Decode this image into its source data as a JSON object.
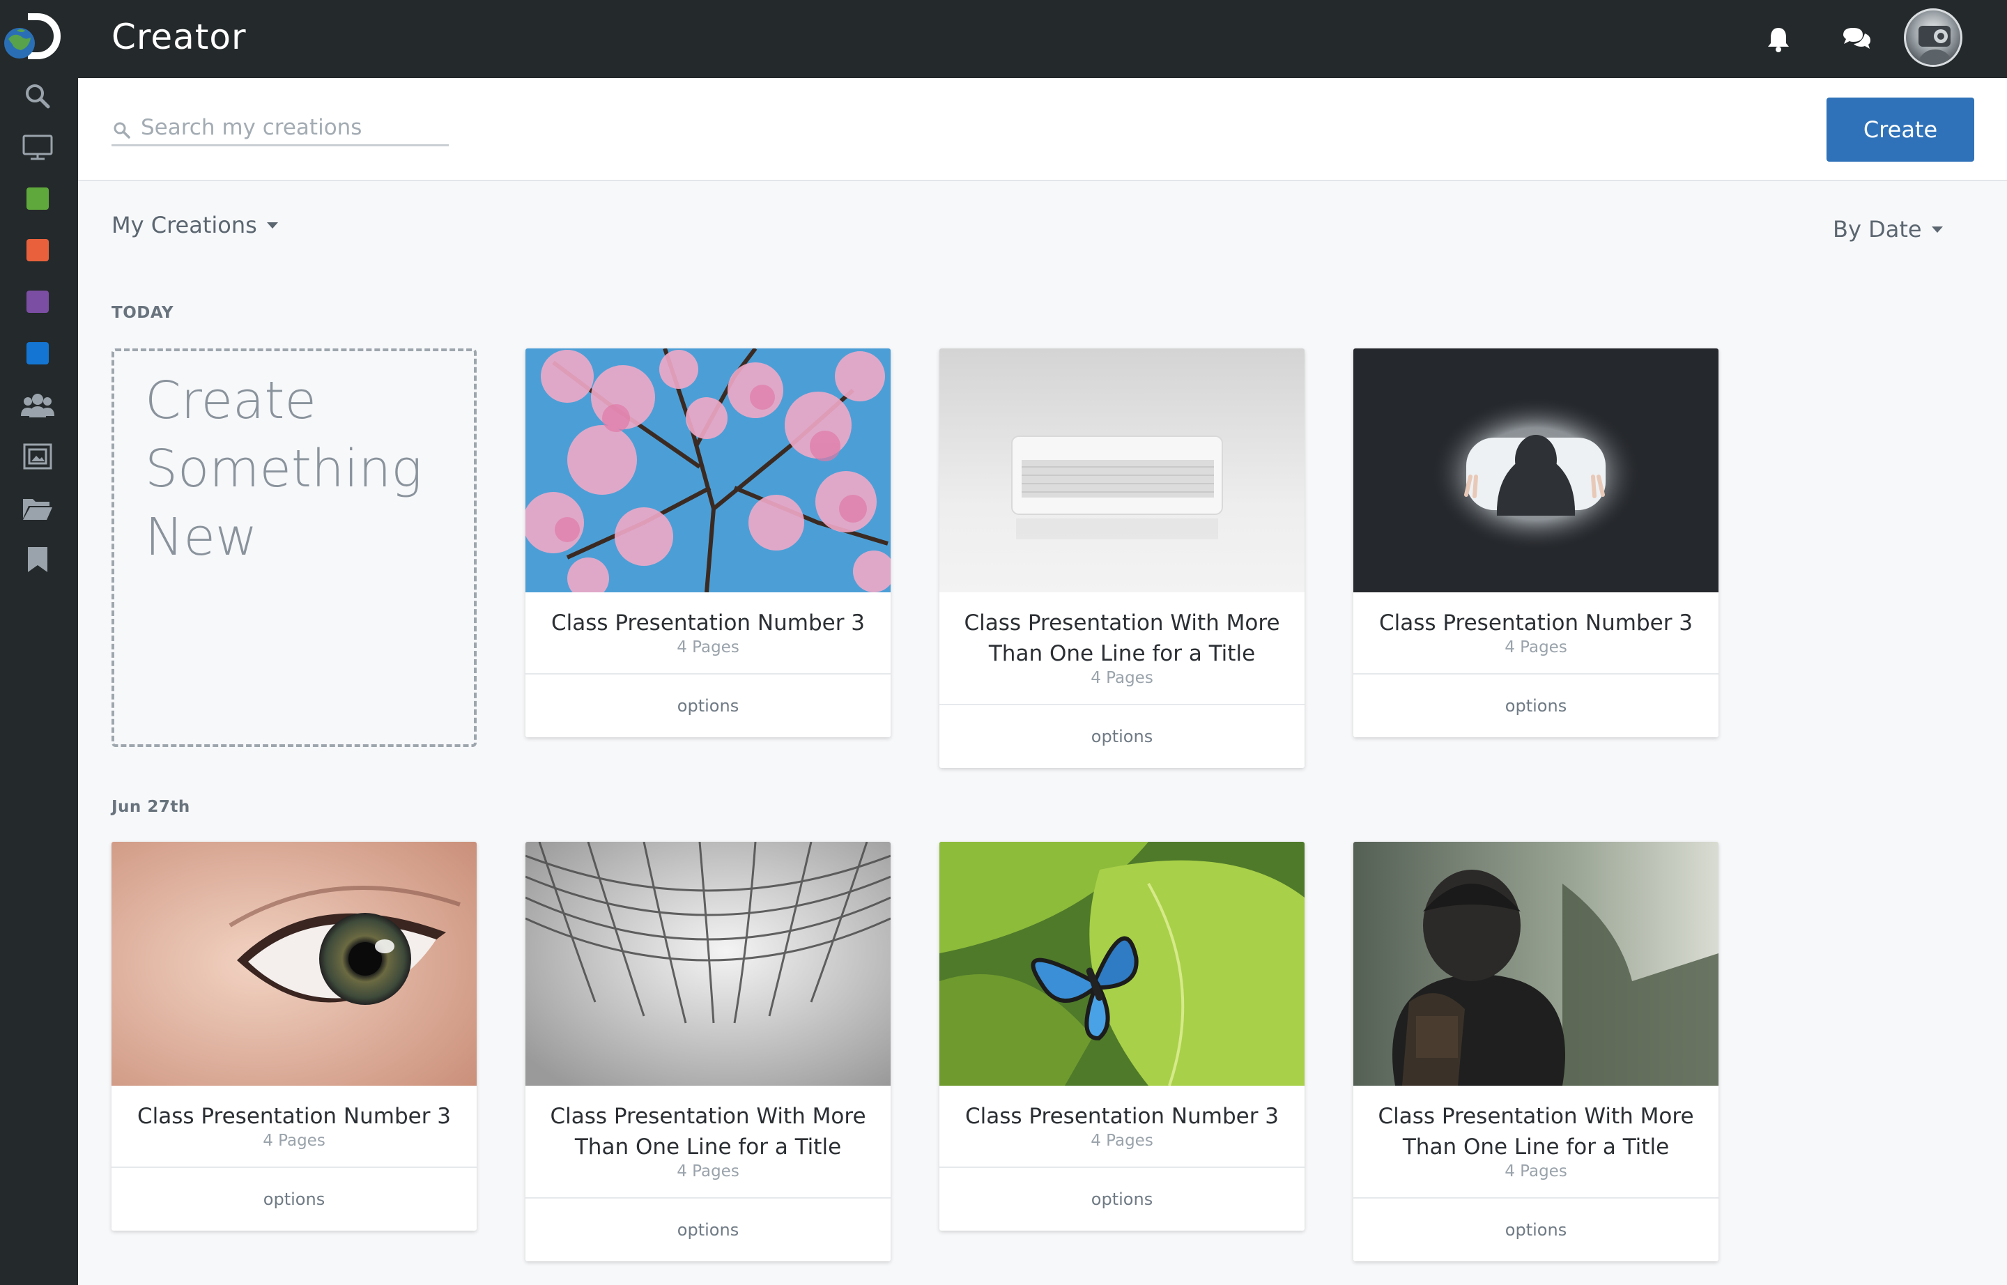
{
  "app": {
    "title": "Creator"
  },
  "sidebar": {
    "items": [
      {
        "icon": "search-icon"
      },
      {
        "icon": "monitor-icon"
      },
      {
        "icon": "green-square-icon",
        "color": "#5fa83b"
      },
      {
        "icon": "orange-square-icon",
        "color": "#e8613c"
      },
      {
        "icon": "purple-square-icon",
        "color": "#7b4ea3"
      },
      {
        "icon": "blue-square-icon",
        "color": "#1476d2"
      },
      {
        "icon": "users-icon"
      },
      {
        "icon": "gallery-icon"
      },
      {
        "icon": "folder-icon"
      },
      {
        "icon": "bookmark-icon"
      }
    ]
  },
  "topbar": {
    "icons": [
      "bell-icon",
      "chat-icon"
    ],
    "avatar": "user-avatar"
  },
  "search": {
    "placeholder": "Search my creations"
  },
  "create_button": "Create",
  "filters": {
    "scope": "My Creations",
    "sort": "By Date"
  },
  "create_new": {
    "lines": [
      "Create",
      "Something",
      "New"
    ]
  },
  "sections": [
    {
      "label": "TODAY",
      "cards": [
        {
          "title": "Class Presentation Number 3",
          "pages": "4 Pages",
          "options": "options",
          "image": "cherry-blossom-photo"
        },
        {
          "title": "Class Presentation With More Than One Line for a Title",
          "pages": "4 Pages",
          "options": "options",
          "image": "speaker-photo"
        },
        {
          "title": "Class Presentation Number 3",
          "pages": "4 Pages",
          "options": "options",
          "image": "silhouette-photo"
        }
      ]
    },
    {
      "label": "Jun 27th",
      "cards": [
        {
          "title": "Class Presentation Number 3",
          "pages": "4 Pages",
          "options": "options",
          "image": "eye-photo"
        },
        {
          "title": "Class Presentation With More Than One Line for a Title",
          "pages": "4 Pages",
          "options": "options",
          "image": "net-photo"
        },
        {
          "title": "Class Presentation Number 3",
          "pages": "4 Pages",
          "options": "options",
          "image": "butterfly-photo"
        },
        {
          "title": "Class Presentation With More Than One Line for a Title",
          "pages": "4 Pages",
          "options": "options",
          "image": "hiker-photo"
        }
      ]
    }
  ],
  "colors": {
    "accent": "#2f72b9",
    "topbar": "#24292b",
    "background": "#f7f8fa"
  }
}
